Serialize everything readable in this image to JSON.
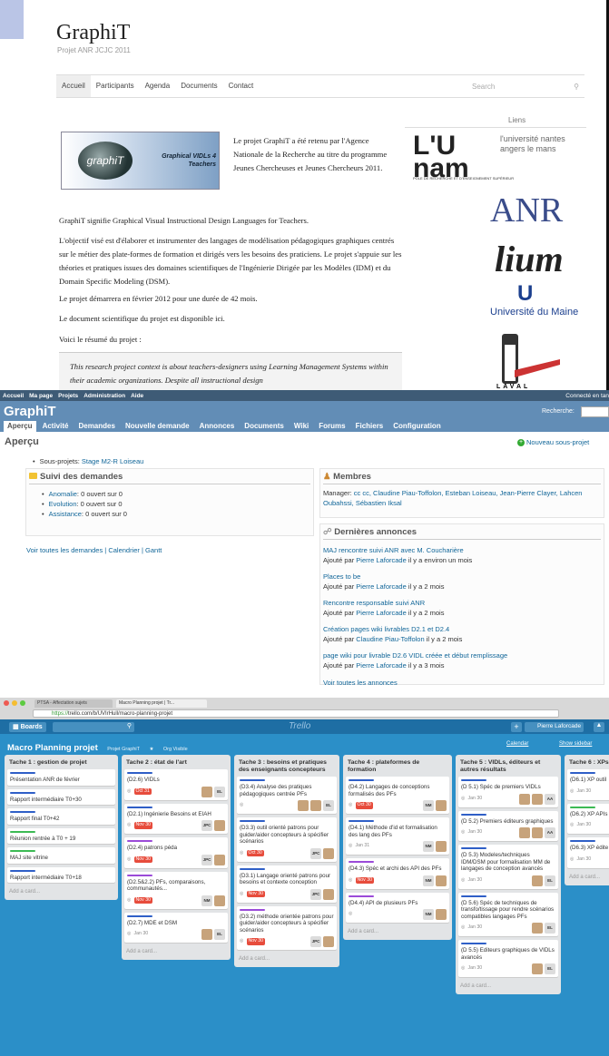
{
  "site": {
    "title": "GraphiT",
    "subtitle": "Projet ANR JCJC 2011",
    "nav": [
      "Accueil",
      "Participants",
      "Agenda",
      "Documents",
      "Contact"
    ],
    "search_placeholder": "Search",
    "liens": "Liens",
    "logo_text_bubble": "graphiT",
    "logo_text_right": "Graphical VIDLs 4 Teachers",
    "intro": "Le projet GraphiT a été retenu par l'Agence Nationale de la Recherche au titre du programme Jeunes Chercheuses et Jeunes Chercheurs 2011.",
    "p1": "GraphiT signifie Graphical Visual Instructional Design Languages for Teachers.",
    "p2": "L'objectif visé est d'élaborer et instrumenter des langages de modélisation pédagogiques graphiques centrés sur le métier des plate-formes de formation et dirigés vers les besoins des praticiens. Le projet s'appuie sur les théories et pratiques issues des domaines scientifiques de l'Ingénierie Dirigée par les Modèles (IDM) et du Domain Specific Modeling (DSM).",
    "p3": "Le projet démarrera en février 2012 pour une durée de 42 mois.",
    "p4": "Le document scientifique du projet est disponible ici.",
    "p5": "Voici le résumé du projet :",
    "quote": "This research project context is about teachers-designers using Learning Management Systems within their academic organizations. Despite all instructional design",
    "partner_univ_big": "L'U nam",
    "partner_univ_small": "l'université nantes angers le mans",
    "partner_univ_tag": "PÔLE DE RECHERCHE ET D'ENSEIGNEMENT SUPÉRIEUR",
    "partner_anr": "ANR",
    "partner_lium": "lium",
    "partner_umaine": "Université du Maine",
    "partner_laval": "LAVAL"
  },
  "redmine": {
    "top_menu": [
      "Accueil",
      "Ma page",
      "Projets",
      "Administration",
      "Aide"
    ],
    "connected": "Connecté en tan",
    "title": "GraphiT",
    "search_label": "Recherche:",
    "tabs": [
      "Aperçu",
      "Activité",
      "Demandes",
      "Nouvelle demande",
      "Annonces",
      "Documents",
      "Wiki",
      "Forums",
      "Fichiers",
      "Configuration"
    ],
    "heading": "Aperçu",
    "new_subproject": "Nouveau sous-projet",
    "subprojects_label": "Sous-projets:",
    "subprojects_link": "Stage M2-R Loiseau",
    "issues_title": "Suivi des demandes",
    "issues": [
      {
        "name": "Anomalie",
        "rest": ": 0 ouvert sur 0"
      },
      {
        "name": "Evolution",
        "rest": ": 0 ouvert sur 0"
      },
      {
        "name": "Assistance",
        "rest": ": 0 ouvert sur 0"
      }
    ],
    "issues_links": "Voir toutes les demandes | Calendrier | Gantt",
    "members_title": "Membres",
    "members_label": "Manager:",
    "members_list": "cc cc, Claudine Piau-Toffolon, Esteban Loiseau, Jean-Pierre Clayer, Lahcen Oubahssi, Sébastien Iksal",
    "news_title": "Dernières annonces",
    "news": [
      {
        "title": "MAJ rencontre suivi ANR avec M. Coucharière",
        "prefix": "Ajouté par",
        "author": "Pierre Laforcade",
        "time": "il y a environ un mois"
      },
      {
        "title": "Places to be",
        "prefix": "Ajouté par",
        "author": "Pierre Laforcade",
        "time": "il y a 2 mois"
      },
      {
        "title": "Rencontre responsable suivi ANR",
        "prefix": "Ajouté par",
        "author": "Pierre Laforcade",
        "time": "il y a 2 mois"
      },
      {
        "title": "Création pages wiki livrables D2.1 et D2.4",
        "prefix": "Ajouté par",
        "author": "Claudine Piau-Toffolon",
        "time": "il y a 2 mois"
      },
      {
        "title": "page wiki pour livrable D2.6 VIDL créée et début remplissage",
        "prefix": "Ajouté par",
        "author": "Pierre Laforcade",
        "time": "il y a 3 mois"
      }
    ],
    "all_news": "Voir toutes les annonces"
  },
  "trello": {
    "tab1": "PTSA - Affectation sujets",
    "tab2": "Macro Planning projet | Tr...",
    "url_prefix": "https://",
    "url": "trello.com/b/UVIrHull/macro-planning-projet",
    "boards": "Boards",
    "logo": "Trello",
    "user": "Pierre Laforcade",
    "board_title": "Macro Planning projet",
    "board_org": "Projet GraphiT",
    "board_vis": "Org Visible",
    "calendar": "Calendar",
    "show_sidebar": "Show sidebar",
    "add_card": "Add a card...",
    "lists": [
      {
        "title": "Tache 1 : gestion de projet",
        "cards": [
          {
            "label": "#2f5fc7",
            "text": "Présentation ANR de février"
          },
          {
            "label": "#2f5fc7",
            "text": "Rapport intermédiaire T0+30"
          },
          {
            "label": "#2f5fc7",
            "text": "Rapport final T0+42"
          },
          {
            "label": "#3cba54",
            "text": "Réunion rentrée à T0 + 19"
          },
          {
            "label": "#3cba54",
            "text": "MAJ site vitrine"
          },
          {
            "label": "#2f5fc7",
            "text": "Rapport intermédiaire T0+18"
          }
        ]
      },
      {
        "title": "Tache 2 : état de l'art",
        "cards": [
          {
            "label": "#2f5fc7",
            "text": "(D2.6) VIDLs",
            "due": "Oct 31",
            "av": [
              "img",
              "EL"
            ]
          },
          {
            "label": "#2f5fc7",
            "text": "(D2.1) Ingénierie Besoins et EIAH",
            "due": "Nov 30",
            "av": [
              "JPC",
              "img"
            ]
          },
          {
            "label": "#9b4bd8",
            "text": "(D2.4) patrons péda",
            "due": "Nov 30",
            "av": [
              "JPC",
              "img"
            ]
          },
          {
            "label": "#9b4bd8",
            "text": "(D2.5&2.2) PFs, comparaisons, communautés...",
            "due": "Nov 30",
            "av": [
              "NM",
              "img"
            ]
          },
          {
            "label": "#2f5fc7",
            "text": "(D2.7) MDE et DSM",
            "date": "Jan 30",
            "av": [
              "img",
              "EL"
            ]
          }
        ]
      },
      {
        "title": "Tache 3 : besoins et pratiques des enseignants concepteurs",
        "cards": [
          {
            "label": "#2f5fc7",
            "text": "(D3.4) Analyse des pratiques pédagogiques centrée PFs",
            "av": [
              "img",
              "img",
              "EL"
            ]
          },
          {
            "label": "#2f5fc7",
            "text": "(D3.3) outil orienté patrons pour guider/aider concepteurs à spécifier scénarios",
            "due": "Oct 30",
            "av": [
              "JPC",
              "img"
            ]
          },
          {
            "label": "#2f5fc7",
            "text": "(D3.1) Langage orienté patrons pour besoins et contexte conception",
            "due": "Nov 30",
            "av": [
              "JPC",
              "img"
            ]
          },
          {
            "label": "#9b4bd8",
            "text": "(D3.2) méthode orientée patrons pour guider/aider concepteurs à spécifier scénarios",
            "due": "Nov 30",
            "av": [
              "JPC",
              "img"
            ]
          }
        ]
      },
      {
        "title": "Tache 4 : plateformes de formation",
        "cards": [
          {
            "label": "#2f5fc7",
            "text": "(D4.2) Langages de conceptions formalisés des PFs",
            "due": "Oct 30",
            "av": [
              "NM",
              "img"
            ]
          },
          {
            "label": "#2f5fc7",
            "text": "(D4.1) Méthode d'id et formalisation des lang des PFs",
            "date": "Jan 31",
            "av": [
              "NM",
              "img"
            ]
          },
          {
            "label": "#9b4bd8",
            "text": "(D4.3) Spéc et archi des API des PFs",
            "due": "Nov 30",
            "av": [
              "NM",
              "img"
            ]
          },
          {
            "label": "#9b4bd8",
            "text": "(D4.4) API de plusieurs PFs",
            "av": [
              "NM",
              "img"
            ]
          }
        ]
      },
      {
        "title": "Tache 5 : VIDLs, éditeurs et autres résultats",
        "cards": [
          {
            "label": "#2f5fc7",
            "text": "(D 5.1) Spéc de premiers VIDLs",
            "date": "Jan 30",
            "av": [
              "img",
              "img",
              "AA"
            ]
          },
          {
            "label": "#2f5fc7",
            "text": "(D 5.2) Premiers éditeurs graphiques",
            "date": "Jan 30",
            "av": [
              "img",
              "img",
              "AA"
            ]
          },
          {
            "label": "#2f5fc7",
            "text": "(D 5.3) Modeles/techniques IDM/DSM pour formalisation MM de langages de conception avancés",
            "date": "Jan 30",
            "av": [
              "img",
              "EL"
            ]
          },
          {
            "label": "#2f5fc7",
            "text": "(D 5.6) Spéc de techniques de transfo/tissage pour rendre scénarios compatibles langages PFs",
            "date": "Jan 30",
            "av": [
              "img",
              "EL"
            ]
          },
          {
            "label": "#2f5fc7",
            "text": "(D 5.5) Editeurs graphiques de VIDLs avancés",
            "date": "Jan 30",
            "av": [
              "img",
              "EL"
            ]
          }
        ]
      },
      {
        "title": "Tache 6 : XPs",
        "cards": [
          {
            "label": "#2f5fc7",
            "text": "(D6.1) XP outil",
            "date": "Jan 30"
          },
          {
            "label": "#3cba54",
            "text": "(D6.2) XP APIs",
            "date": "Jan 30"
          },
          {
            "label": "#2f5fc7",
            "text": "(D6.3) XP édite",
            "date": "Jan 30"
          }
        ]
      }
    ]
  }
}
